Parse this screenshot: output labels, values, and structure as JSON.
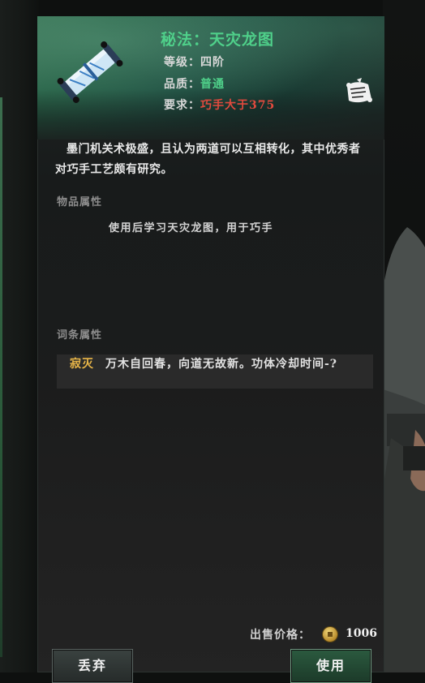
{
  "item": {
    "title": "秘法：天灾龙图",
    "level_label": "等级：",
    "level_value": "四阶",
    "quality_label": "品质：",
    "quality_value": "普通",
    "require_label": "要求：",
    "require_value": "巧手大于375"
  },
  "description": "墨门机关术极盛，且认为两道可以互相转化，其中优秀者对巧手工艺颇有研究。",
  "attributes": {
    "label": "物品属性",
    "text": "使用后学习天灾龙图，用于巧手"
  },
  "affixes": {
    "label": "词条属性",
    "name": "寂灭",
    "text": "万木自回春，向道无故新。功体冷却时间-?"
  },
  "price": {
    "label": "出售价格：",
    "value": "1006"
  },
  "buttons": {
    "discard": "丢弃",
    "use": "使用"
  },
  "colors": {
    "title_green": "#4fd08a",
    "require_red": "#e24a3e",
    "affix_gold": "#e9b648"
  },
  "icons": {
    "item": "scroll-icon",
    "mark": "scroll-mark-icon",
    "currency": "coin-icon"
  }
}
